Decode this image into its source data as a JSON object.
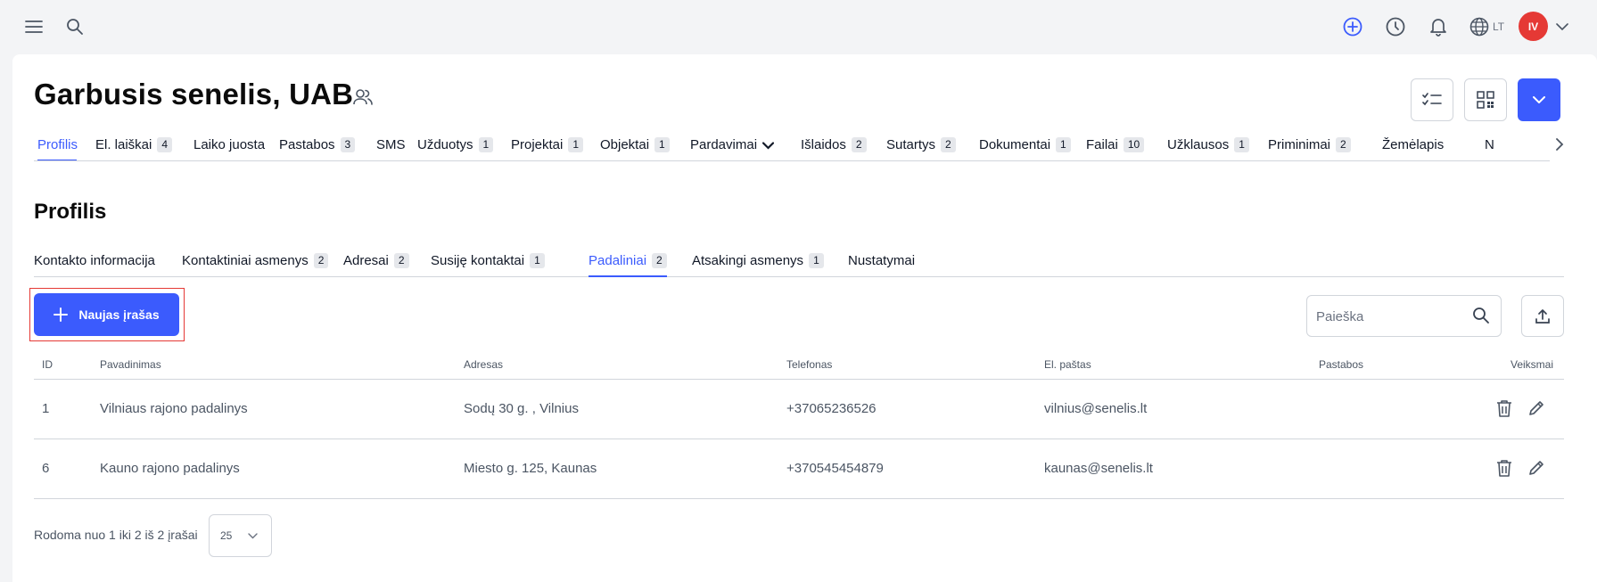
{
  "topbar": {
    "menu_icon": "hamburger-menu-icon",
    "search_icon": "search-icon",
    "add_icon": "plus-circle-icon",
    "history_icon": "clock-icon",
    "notifications_icon": "bell-icon",
    "language_icon": "globe-icon",
    "language_code": "LT",
    "avatar_initials": "IV",
    "account_caret_icon": "chevron-down-icon"
  },
  "header": {
    "title": "Garbusis senelis, UAB",
    "title_icon": "contacts-people-icon",
    "buttons": [
      {
        "name": "checklist-button",
        "icon": "checklist-icon"
      },
      {
        "name": "qr-code-button",
        "icon": "qr-code-icon"
      },
      {
        "name": "actions-dropdown-button",
        "icon": "chevron-down-icon"
      }
    ]
  },
  "main_tabs": [
    {
      "label": "Profilis",
      "badge": "",
      "active": true
    },
    {
      "label": "El. laiškai",
      "badge": "4"
    },
    {
      "label": "Laiko juosta",
      "badge": ""
    },
    {
      "label": "Pastabos",
      "badge": "3"
    },
    {
      "label": "SMS",
      "badge": ""
    },
    {
      "label": "Užduotys",
      "badge": "1"
    },
    {
      "label": "Projektai",
      "badge": "1"
    },
    {
      "label": "Objektai",
      "badge": "1"
    },
    {
      "label": "Pardavimai",
      "badge": ""
    },
    {
      "label": "Išlaidos",
      "badge": "2"
    },
    {
      "label": "Sutartys",
      "badge": "2"
    },
    {
      "label": "Dokumentai",
      "badge": "1"
    },
    {
      "label": "Failai",
      "badge": "10"
    },
    {
      "label": "Užklausos",
      "badge": "1"
    },
    {
      "label": "Priminimai",
      "badge": "2"
    },
    {
      "label": "Žemėlapis",
      "badge": ""
    },
    {
      "label": "N",
      "badge": ""
    }
  ],
  "section_title": "Profilis",
  "sub_tabs": [
    {
      "label": "Kontakto informacija",
      "badge": ""
    },
    {
      "label": "Kontaktiniai asmenys",
      "badge": "2"
    },
    {
      "label": "Adresai",
      "badge": "2"
    },
    {
      "label": "Susiję kontaktai",
      "badge": "1"
    },
    {
      "label": "Padaliniai",
      "badge": "2",
      "active": true
    },
    {
      "label": "Atsakingi asmenys",
      "badge": "1"
    },
    {
      "label": "Nustatymai",
      "badge": ""
    }
  ],
  "toolbar": {
    "new_record_label": "Naujas įrašas",
    "search_placeholder": "Paieška",
    "export_icon": "upload-icon"
  },
  "table": {
    "headers": [
      "ID",
      "Pavadinimas",
      "Adresas",
      "Telefonas",
      "El. paštas",
      "Pastabos",
      "Veiksmai"
    ],
    "rows": [
      {
        "id": "1",
        "name": "Vilniaus rajono padalinys",
        "address": "Sodų 30 g. , Vilnius",
        "phone": "+37065236526",
        "email": "vilnius@senelis.lt",
        "notes": ""
      },
      {
        "id": "6",
        "name": "Kauno rajono padalinys",
        "address": "Miesto g. 125, Kaunas",
        "phone": "+370545454879",
        "email": "kaunas@senelis.lt",
        "notes": ""
      }
    ]
  },
  "pagination": {
    "summary": "Rodoma nuo 1 iki 2 iš 2 įrašai",
    "page_size": "25"
  },
  "colors": {
    "accent": "#3b5bfd",
    "avatar": "#e53935",
    "highlight_border": "#e53935"
  }
}
